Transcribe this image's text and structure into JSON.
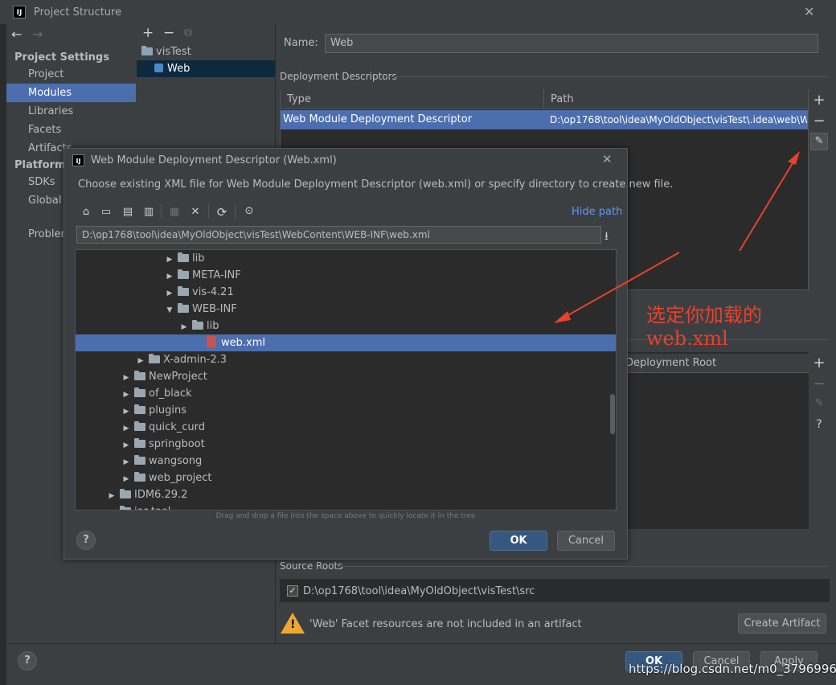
{
  "window": {
    "title": "Project Structure",
    "logo": "IJ"
  },
  "nav": {
    "back_icon": "←",
    "forward_icon": "→"
  },
  "sidebar": {
    "project_settings": "Project Settings",
    "items": [
      "Project",
      "Modules",
      "Libraries",
      "Facets",
      "Artifacts"
    ],
    "selected": "Modules",
    "platform_settings": "Platform S",
    "platform_items": [
      "SDKs",
      "Global L"
    ],
    "problems": "Problen"
  },
  "modules": {
    "toolbar": {
      "add": "+",
      "remove": "−",
      "copy": "⧉"
    },
    "tree": [
      "visTest",
      "Web"
    ]
  },
  "main": {
    "name_label": "Name:",
    "name_value": "Web",
    "deployment_descriptors": "Deployment Descriptors",
    "table": {
      "columns": [
        "Type",
        "Path"
      ],
      "rows": [
        [
          "Web Module Deployment Descriptor",
          "D:\\op1768\\tool\\idea\\MyOldObject\\visTest\\.idea\\web\\W"
        ]
      ]
    },
    "side_buttons": {
      "add": "+",
      "remove": "−",
      "edit": "✎"
    },
    "second_table": {
      "column": "Deployment Root",
      "side_buttons": [
        "+",
        "−",
        "✎",
        "?"
      ]
    },
    "source_roots_label": "Source Roots",
    "source_root": "D:\\op1768\\tool\\idea\\MyOldObject\\visTest\\src",
    "source_root_checked": "✓",
    "warning": "'Web' Facet resources are not included in an artifact",
    "create_artifact": "Create Artifact"
  },
  "footer": {
    "help": "?",
    "ok": "OK",
    "cancel": "Cancel",
    "apply": "Apply"
  },
  "dialog": {
    "title": "Web Module Deployment Descriptor (Web.xml)",
    "logo": "IJ",
    "close": "✕",
    "description": "Choose existing XML file for Web Module Deployment Descriptor (web.xml) or specify directory to create new file.",
    "toolbar_icons": [
      "⌂",
      "▭",
      "▤",
      "▥",
      "▦",
      "✕",
      "⟳",
      "⊙"
    ],
    "hide_path": "Hide path",
    "path": "D:\\op1768\\tool\\idea\\MyOldObject\\visTest\\WebContent\\WEB-INF\\web.xml",
    "download_icon": "⭳",
    "tree": [
      {
        "label": "lib",
        "indent": 7,
        "arrow": "▶"
      },
      {
        "label": "META-INF",
        "indent": 7,
        "arrow": "▶"
      },
      {
        "label": "vis-4.21",
        "indent": 7,
        "arrow": "▶"
      },
      {
        "label": "WEB-INF",
        "indent": 7,
        "arrow": "▼"
      },
      {
        "label": "lib",
        "indent": 8,
        "arrow": "▶"
      },
      {
        "label": "web.xml",
        "indent": 9,
        "arrow": "",
        "file": true,
        "selected": true
      },
      {
        "label": "X-admin-2.3",
        "indent": 5,
        "arrow": "▶"
      },
      {
        "label": "NewProject",
        "indent": 4,
        "arrow": "▶"
      },
      {
        "label": "of_black",
        "indent": 4,
        "arrow": "▶"
      },
      {
        "label": "plugins",
        "indent": 4,
        "arrow": "▶"
      },
      {
        "label": "quick_curd",
        "indent": 4,
        "arrow": "▶"
      },
      {
        "label": "springboot",
        "indent": 4,
        "arrow": "▶"
      },
      {
        "label": "wangsong",
        "indent": 4,
        "arrow": "▶"
      },
      {
        "label": "web_project",
        "indent": 4,
        "arrow": "▶"
      },
      {
        "label": "IDM6.29.2",
        "indent": 3,
        "arrow": "▶"
      },
      {
        "label": "jar-tool",
        "indent": 3,
        "arrow": "▶"
      }
    ],
    "hint": "Drag and drop a file into the space above to quickly locate it in the tree",
    "help": "?",
    "ok": "OK",
    "cancel": "Cancel"
  },
  "annotation": {
    "line1": "选定你加载的",
    "line2": "web.xml",
    "color": "#e8412c"
  },
  "watermark": "https://blog.csdn.net/m0_37969960"
}
